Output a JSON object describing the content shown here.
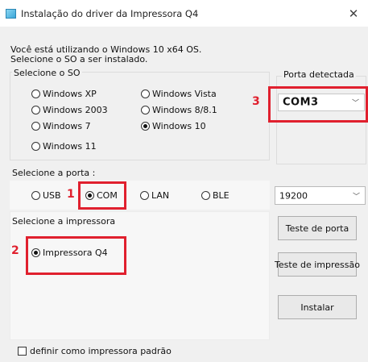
{
  "window": {
    "title": "Instalação do driver da Impressora Q4",
    "close_glyph": "✕",
    "icon": "app-icon"
  },
  "info": {
    "line1": "Você está utilizando o Windows 10 x64 OS.",
    "line2": "Selecione o SO a ser instalado."
  },
  "os_group": {
    "legend": "Selecione o SO",
    "options": [
      {
        "label": "Windows XP",
        "checked": false
      },
      {
        "label": "Windows Vista",
        "checked": false
      },
      {
        "label": "Windows 2003",
        "checked": false
      },
      {
        "label": "Windows 8/8.1",
        "checked": false
      },
      {
        "label": "Windows 7",
        "checked": false
      },
      {
        "label": "Windows 10",
        "checked": true
      },
      {
        "label": "Windows 11",
        "checked": false
      }
    ]
  },
  "port_group": {
    "legend": "Porta detectada",
    "value": "COM3",
    "chevron": "﹀"
  },
  "port_select": {
    "label": "Selecione a porta :",
    "options": [
      {
        "label": "USB",
        "checked": false
      },
      {
        "label": "COM",
        "checked": true
      },
      {
        "label": "LAN",
        "checked": false
      },
      {
        "label": "BLE",
        "checked": false
      }
    ]
  },
  "baud": {
    "value": "19200",
    "chevron": "﹀"
  },
  "printer_group": {
    "label": "Selecione a impressora",
    "option": {
      "label": "Impressora Q4",
      "checked": true
    }
  },
  "buttons": {
    "test_port": "Teste de porta",
    "test_print": "Teste de impressão",
    "install": "Instalar"
  },
  "default_printer": {
    "label": "definir como impressora padrão",
    "checked": false
  },
  "annotations": {
    "n1": "1",
    "n2": "2",
    "n3": "3",
    "color": "#e0202e"
  }
}
